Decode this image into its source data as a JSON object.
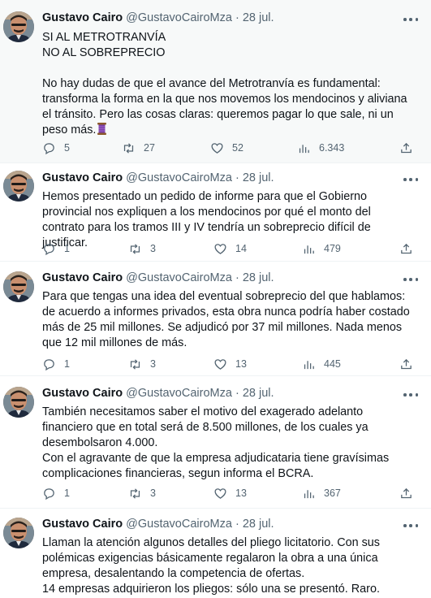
{
  "author": {
    "name": "Gustavo Cairo",
    "handle": "@GustavoCairoMza",
    "sep": "·"
  },
  "tweets": [
    {
      "date": "28 jul.",
      "text": "SI AL METROTRANVÍA\nNO AL SOBREPRECIO\n\nNo hay dudas de que el avance del Metrotranvía es fundamental: transforma la forma en la que nos movemos los mendocinos y aliviana el tránsito. Pero las cosas claras: queremos pagar lo que sale, ni un peso más.",
      "replies": "5",
      "retweets": "27",
      "likes": "52",
      "views": "6.343"
    },
    {
      "date": "28 jul.",
      "text": "Hemos presentado un pedido de informe para que el Gobierno provincial nos expliquen a los mendocinos por qué el monto del contrato para los tramos III y IV tendría un sobreprecio difícil de justificar.",
      "replies": "1",
      "retweets": "3",
      "likes": "14",
      "views": "479"
    },
    {
      "date": "28 jul.",
      "text": "Para que tengas una idea del eventual sobreprecio del que hablamos: de acuerdo a informes privados, esta obra nunca podría haber costado más de 25 mil millones. Se adjudicó por 37 mil millones. Nada menos que 12 mil millones de más.",
      "replies": "1",
      "retweets": "3",
      "likes": "13",
      "views": "445"
    },
    {
      "date": "28 jul.",
      "text": "También necesitamos saber el motivo del exagerado adelanto financiero que en total será de 8.500 millones, de los cuales ya desembolsaron 4.000.\nCon el agravante de que la empresa adjudicataria tiene gravísimas complicaciones financieras, segun informa el BCRA.",
      "replies": "1",
      "retweets": "3",
      "likes": "13",
      "views": "367"
    },
    {
      "date": "28 jul.",
      "text": "Llaman la atención algunos detalles del pliego licitatorio. Con sus polémicas exigencias básicamente regalaron la obra a una única empresa, desalentando la competencia de ofertas.\n14 empresas adquirieron los pliegos: sólo una se presentó. Raro."
    }
  ],
  "icons": {
    "reply": "reply-icon",
    "retweet": "retweet-icon",
    "like": "heart-icon",
    "views": "views-icon",
    "share": "share-icon",
    "more": "more-icon",
    "emoji": "thread-spool-emoji"
  },
  "colors": {
    "text": "#0f1419",
    "secondary": "#536471",
    "highlight_bg": "#f7f9f9",
    "divider": "#eff3f4"
  }
}
